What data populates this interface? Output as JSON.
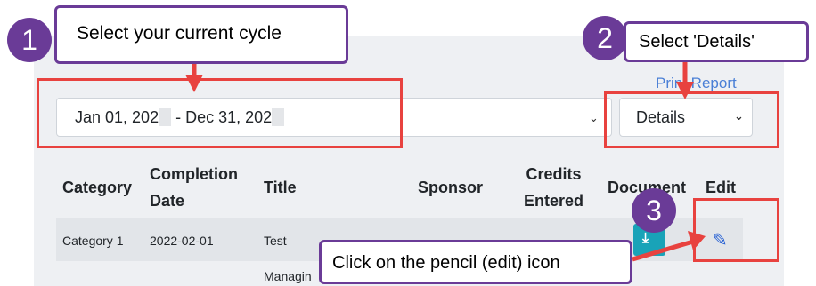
{
  "print_report": "Print Report",
  "cycle_select": {
    "start": "Jan 01, 202",
    "end": "- Dec 31, 202"
  },
  "view_select": {
    "value": "Details"
  },
  "table": {
    "headers": {
      "category": "Category",
      "completion_line1": "Completion",
      "completion_line2": "Date",
      "title": "Title",
      "sponsor": "Sponsor",
      "credits_line1": "Credits",
      "credits_line2": "Entered",
      "document": "Document",
      "edit": "Edit"
    },
    "row": {
      "category": "Category 1",
      "completion_date": "2022-02-01",
      "title": "Test",
      "title_line2": "Managin"
    }
  },
  "annotations": {
    "step1": {
      "number": "1",
      "text": "Select your current cycle"
    },
    "step2": {
      "number": "2",
      "text": "Select 'Details'"
    },
    "step3": {
      "number": "3",
      "text": "Click on the pencil (edit) icon"
    }
  },
  "colors": {
    "highlight": "#e8423f",
    "callout_border": "#6a3b97",
    "link": "#4a7fd6",
    "doc_button": "#19a3b8"
  },
  "icons": {
    "chevron": "chevron-down-icon",
    "document": "download-icon",
    "edit": "pencil-icon"
  }
}
